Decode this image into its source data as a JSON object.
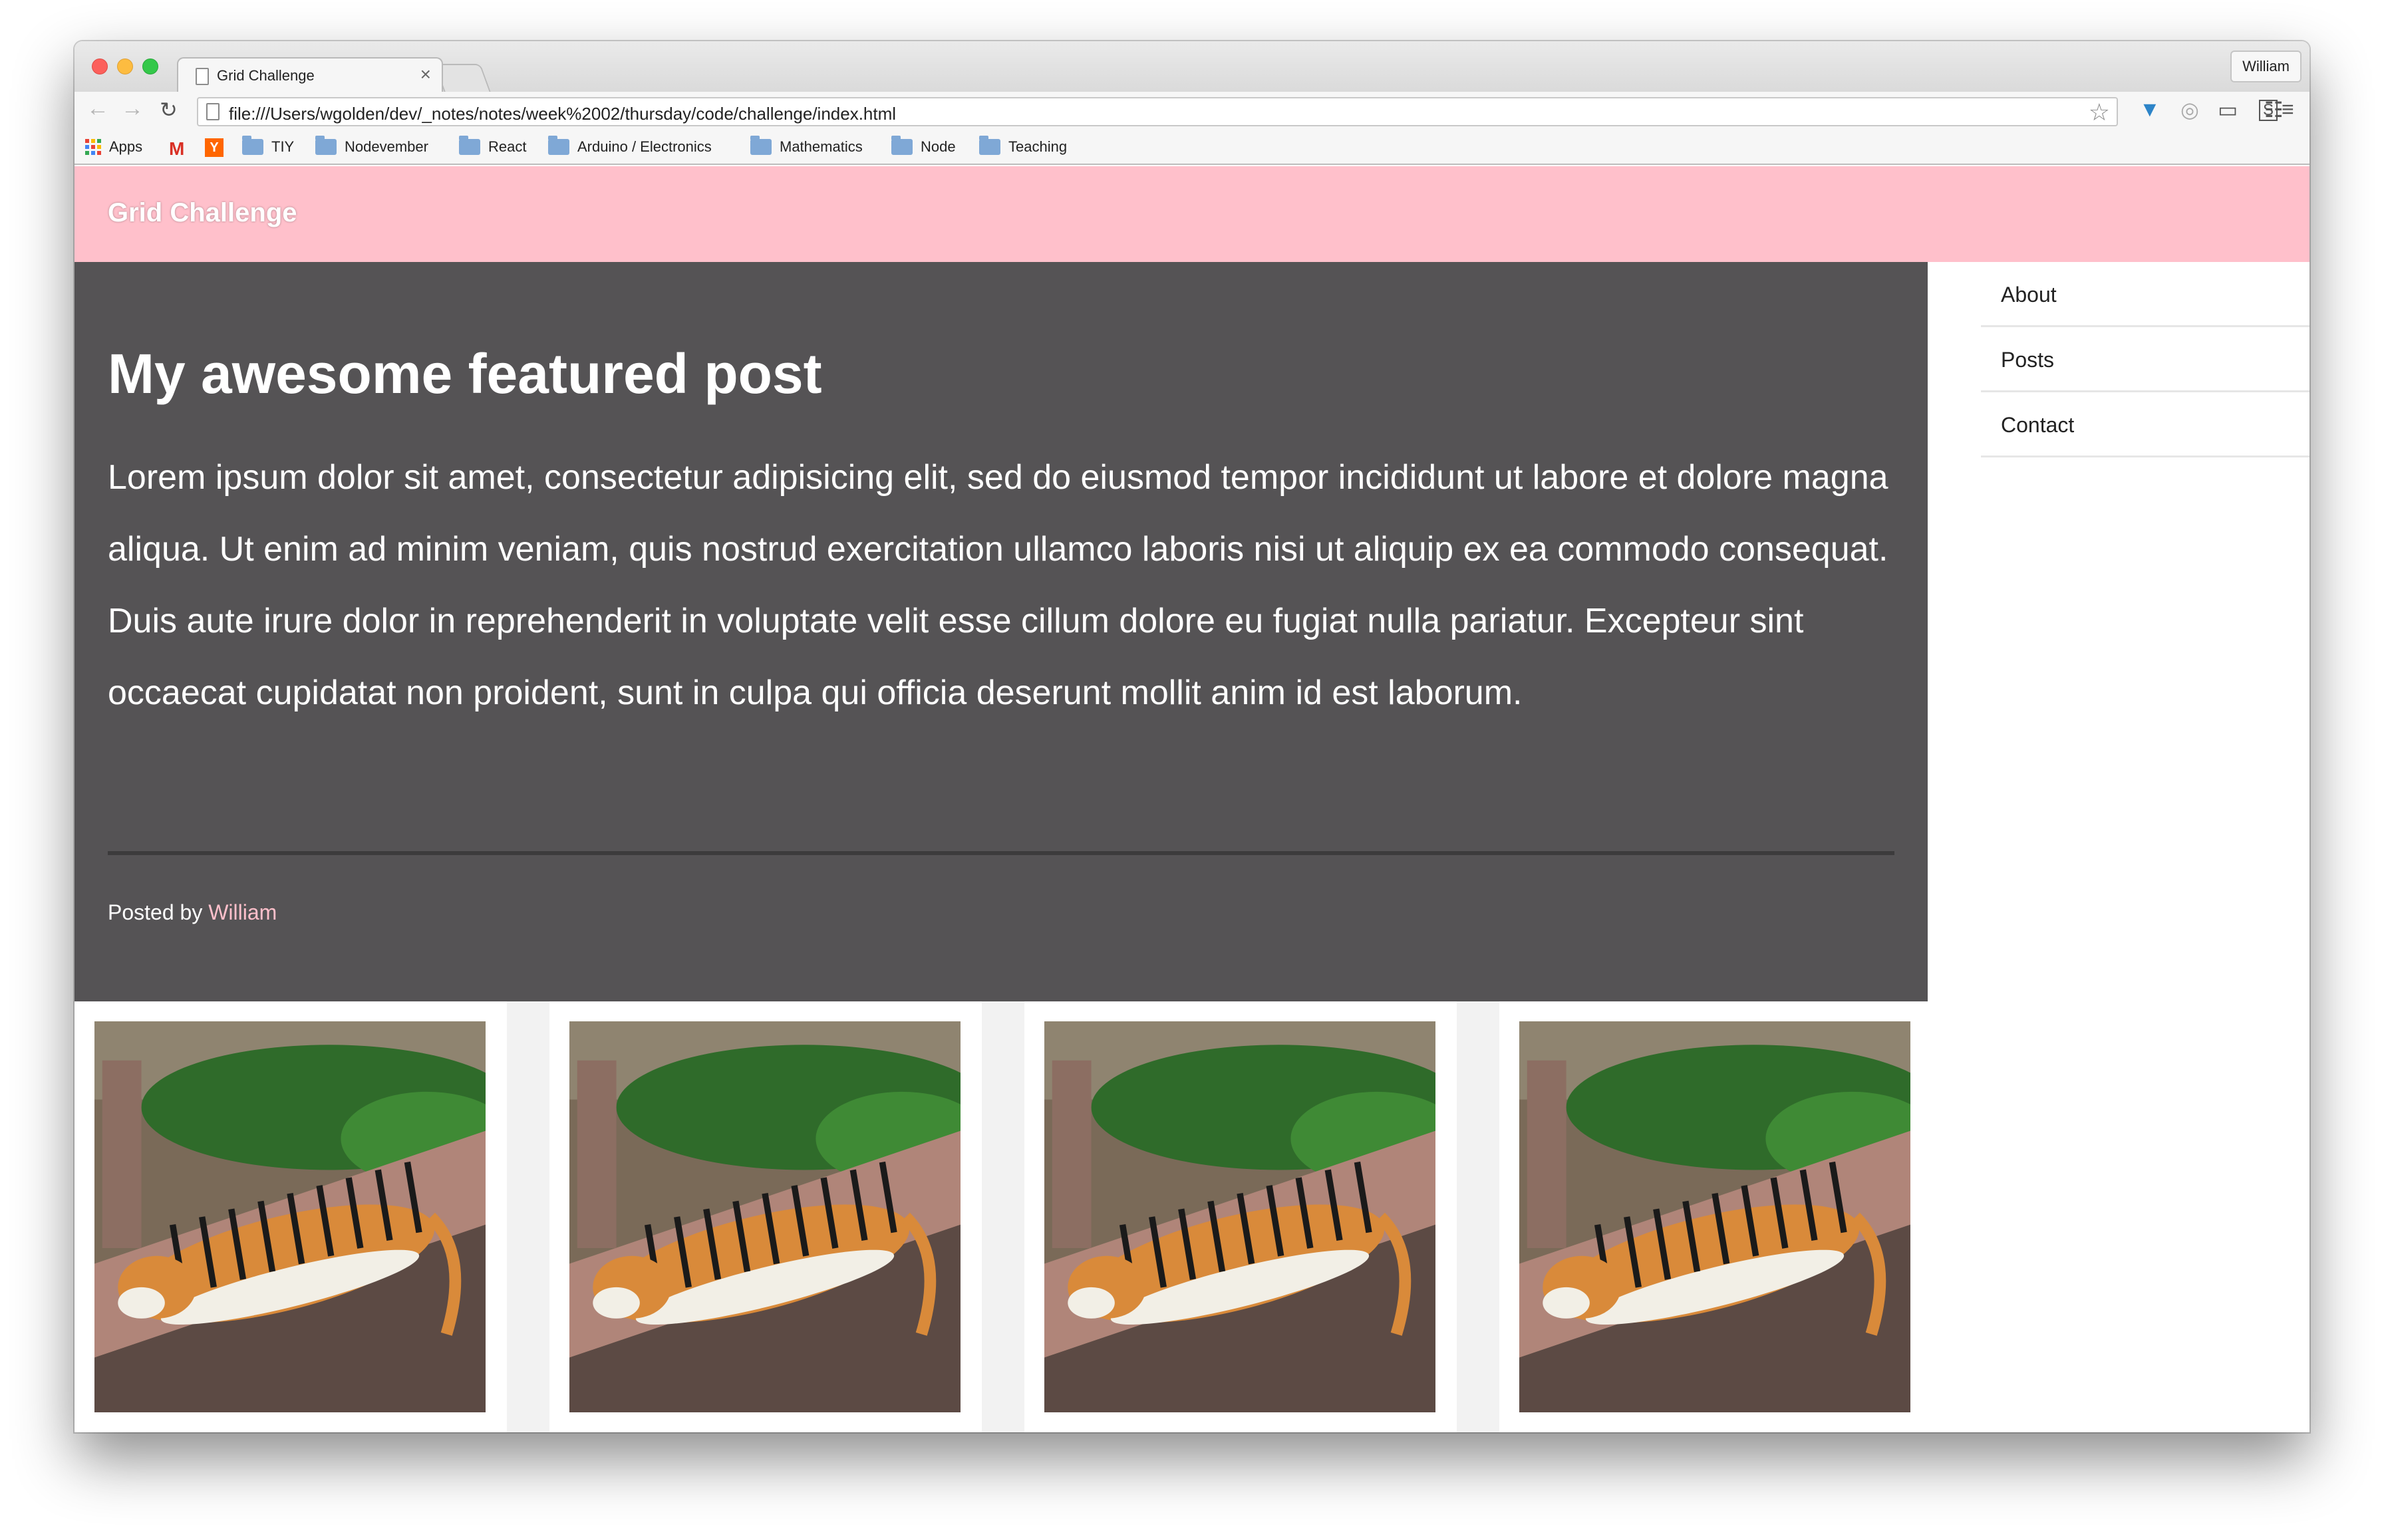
{
  "browser": {
    "tab_title": "Grid Challenge",
    "tab_close": "×",
    "profile_name": "William",
    "url": "file:///Users/wgolden/dev/_notes/notes/week%2002/thursday/code/challenge/index.html",
    "bookmarks": [
      {
        "label": "Apps",
        "icon": "apps-grid-icon"
      },
      {
        "label": "",
        "icon": "gmail-icon"
      },
      {
        "label": "",
        "icon": "hacker-news-icon"
      },
      {
        "label": "TIY",
        "icon": "folder-icon"
      },
      {
        "label": "Nodevember",
        "icon": "folder-icon"
      },
      {
        "label": "React",
        "icon": "folder-icon"
      },
      {
        "label": "Arduino / Electronics",
        "icon": "folder-icon"
      },
      {
        "label": "Mathematics",
        "icon": "folder-icon"
      },
      {
        "label": "Node",
        "icon": "folder-icon"
      },
      {
        "label": "Teaching",
        "icon": "folder-icon"
      }
    ]
  },
  "site": {
    "title": "Grid Challenge",
    "colors": {
      "header": "#ffc0cb",
      "featured_bg": "#555355",
      "author_link": "#ffc0cb"
    }
  },
  "featured": {
    "title": "My awesome featured post",
    "body": "Lorem ipsum dolor sit amet, consectetur adipisicing elit, sed do eiusmod tempor incididunt ut labore et dolore magna aliqua. Ut enim ad minim veniam, quis nostrud exercitation ullamco laboris nisi ut aliquip ex ea commodo consequat. Duis aute irure dolor in reprehenderit in voluptate velit esse cillum dolore eu fugiat nulla pariatur. Excepteur sint occaecat cupidatat non proident, sunt in culpa qui officia deserunt mollit anim id est laborum.",
    "posted_by_label": "Posted by",
    "author": "William"
  },
  "sidebar": {
    "items": [
      {
        "label": "About"
      },
      {
        "label": "Posts"
      },
      {
        "label": "Contact"
      }
    ]
  },
  "gallery": {
    "images": [
      {
        "subject": "sleeping-tiger-photo"
      },
      {
        "subject": "sleeping-tiger-photo"
      },
      {
        "subject": "sleeping-tiger-photo"
      },
      {
        "subject": "sleeping-tiger-photo"
      }
    ]
  }
}
